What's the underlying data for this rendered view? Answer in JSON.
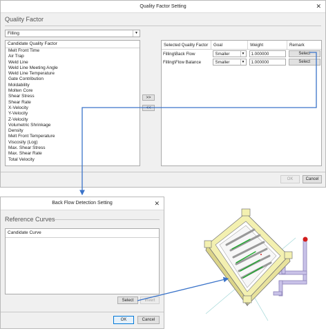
{
  "quality_dialog": {
    "title": "Quality Factor Setting",
    "close_glyph": "✕",
    "section_title": "Quality Factor",
    "category_value": "Filling",
    "candidate_header": "Candidate Quality Factor",
    "candidates": [
      "Melt Front Time",
      "Air Trap",
      "Weld Line",
      "Weld Line Meeting Angle",
      "Weld Line Temperature",
      "Gate Contribution",
      "Moldability",
      "Molten Core",
      "Shear Stress",
      "Shear Rate",
      "X-Velocity",
      "Y-Velocity",
      "Z-Velocity",
      "Volumetric Shrinkage",
      "Density",
      "Melt Front Temperature",
      "Viscosity (Log)",
      "Max. Shear Stress",
      "Max. Shear Rate",
      "Total Velocity"
    ],
    "add_button": ">>",
    "remove_button": "<<",
    "selected_columns": [
      "Selected Quality Factor",
      "Goal",
      "Weight",
      "Remark"
    ],
    "selected_rows": [
      {
        "factor": "Filling\\Back Flow",
        "goal": "Smaller",
        "weight": "1.000000",
        "remark": "Select"
      },
      {
        "factor": "Filling\\Flow Balance",
        "goal": "Smaller",
        "weight": "1.000000",
        "remark": "Select"
      }
    ],
    "ok_label": "OK",
    "cancel_label": "Cancel"
  },
  "backflow_dialog": {
    "title": "Back Flow Detection Setting",
    "close_glyph": "✕",
    "section_title": "Reference Curves",
    "list_header": "Candidate Curve",
    "select_label": "Select",
    "invert_label": "Invert",
    "ok_label": "OK",
    "cancel_label": "Cancel"
  },
  "colors": {
    "arrow": "#3a73c9",
    "curve_green": "#1aaa2a",
    "mold_yellow": "#f3f0b0",
    "runner_purple": "#c9c2e8",
    "gate_red": "#d21c1c"
  },
  "icons": [
    "dropdown-arrow-icon",
    "close-icon",
    "arrow-connector"
  ]
}
